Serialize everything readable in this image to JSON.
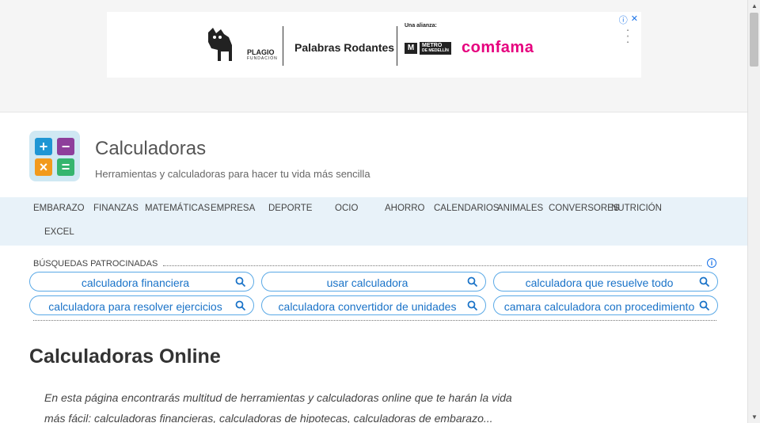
{
  "ad": {
    "info_label": "ⓘ",
    "close_label": "✕",
    "plagio_name": "PLAGIO",
    "plagio_sub": "FUNDACIÓN",
    "palabras": "Palabras Rodantes",
    "alianza": "Una alianza:",
    "metro_name": "METRO",
    "metro_sub": "DE MEDELLÍN",
    "comfama": "comfama"
  },
  "header": {
    "title": "Calculadoras",
    "subtitle": "Herramientas y calculadoras para hacer tu vida más sencilla"
  },
  "nav": {
    "items": [
      "EMBARAZO",
      "FINANZAS",
      "MATEMÁTICAS",
      "EMPRESA",
      "DEPORTE",
      "OCIO",
      "AHORRO",
      "CALENDARIOS",
      "ANIMALES",
      "CONVERSORES",
      "NUTRICIÓN",
      "EXCEL"
    ]
  },
  "sponsored": {
    "label": "BÚSQUEDAS PATROCINADAS",
    "searches": [
      "calculadora financiera",
      "usar calculadora",
      "calculadora que resuelve todo",
      "calculadora para resolver ejercicios",
      "calculadora convertidor de unidades",
      "camara calculadora con procedimiento"
    ]
  },
  "main": {
    "heading": "Calculadoras Online",
    "intro_line1": "En esta página encontrarás multitud de herramientas y calculadoras online que te harán la vida",
    "intro_line2": "más fácil: calculadoras financieras, calculadoras de hipotecas, calculadoras de embarazo..."
  },
  "colors": {
    "accent": "#1a73c8",
    "nav_bg": "#e8f2f9",
    "brand_pink": "#e6007e",
    "tile_blue": "#1e96d4",
    "tile_purple": "#8e3f9b",
    "tile_orange": "#f29a1c",
    "tile_green": "#35b56e"
  },
  "icons": [
    "info-icon",
    "close-icon",
    "search-icon",
    "calculator-logo-icon"
  ]
}
